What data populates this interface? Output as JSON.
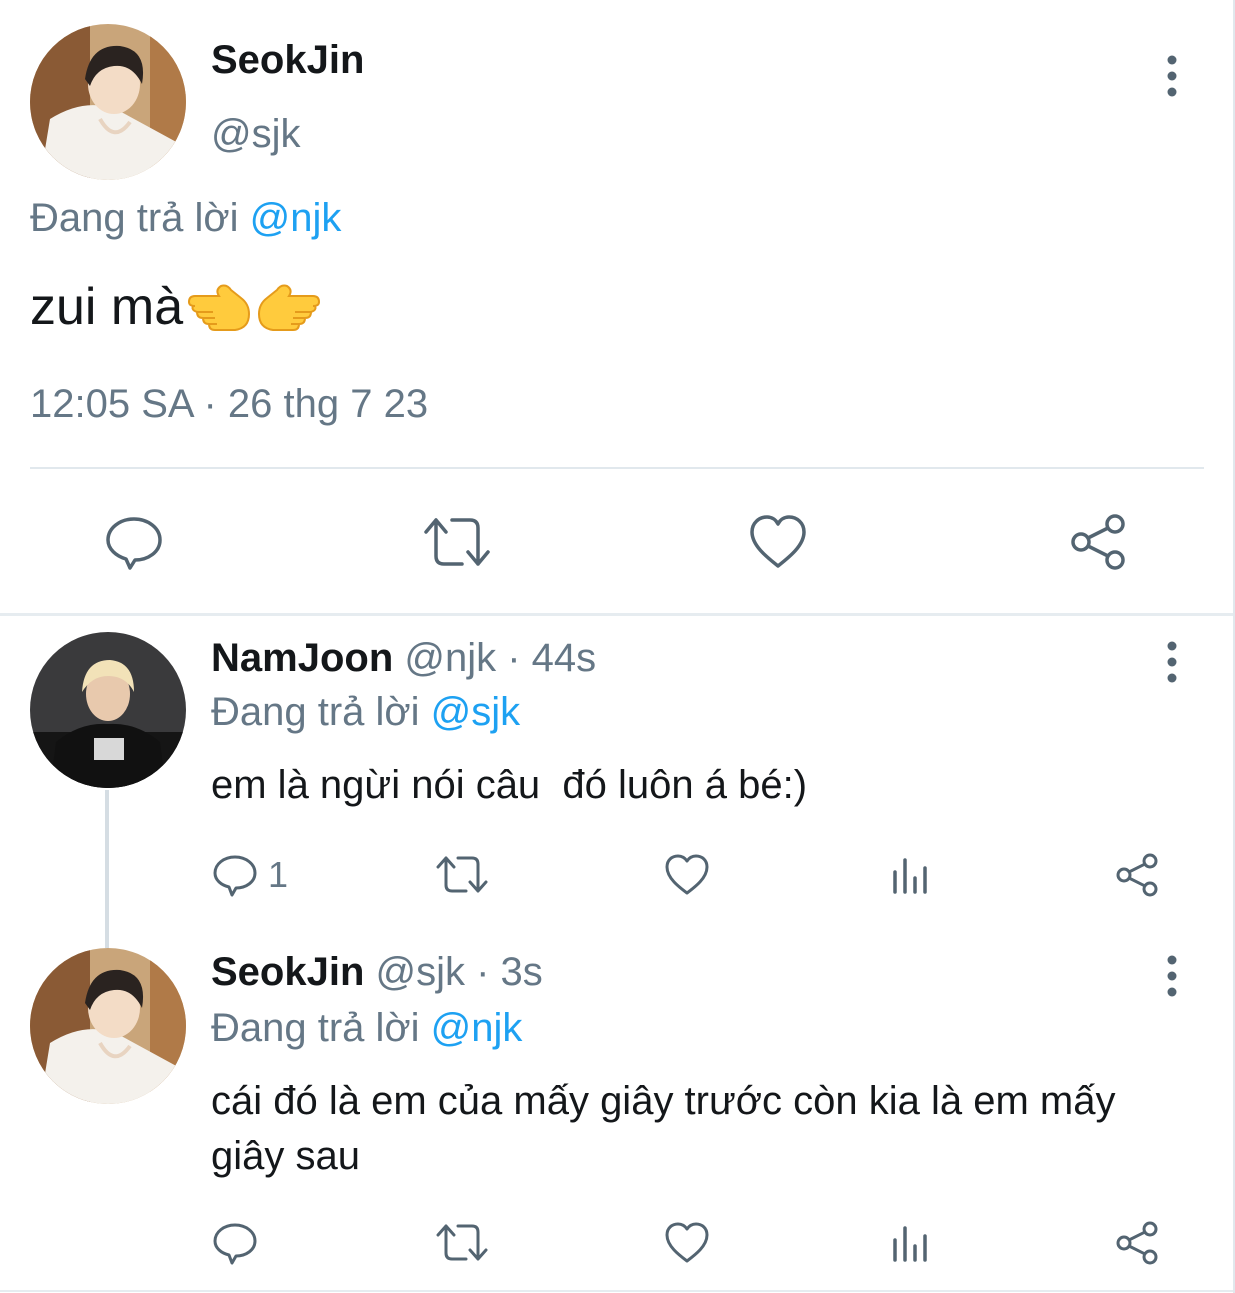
{
  "main_tweet": {
    "name": "SeokJin",
    "handle": "@sjk",
    "reply_prefix": "Đang trả lời ",
    "reply_mention": "@njk",
    "text": "zui mà",
    "emoji": [
      "backhand-index-pointing-left",
      "backhand-index-pointing-right"
    ],
    "timestamp": "12:05 SA · 26 thg 7 23",
    "actions": [
      "reply-icon",
      "retweet-icon",
      "like-icon",
      "share-icon"
    ]
  },
  "replies": [
    {
      "name": "NamJoon",
      "handle_time": " @njk · 44s",
      "reply_prefix": "Đang trả lời ",
      "reply_mention": "@sjk",
      "text": "em là ngừi nói câu  đó luôn á bé:)",
      "reply_count": "1"
    },
    {
      "name": "SeokJin",
      "handle_time": " @sjk · 3s",
      "reply_prefix": "Đang trả lời ",
      "reply_mention": "@njk",
      "text": "cái đó là em của mấy giây trước còn kia là em mấy giây sau",
      "reply_count": ""
    }
  ],
  "colors": {
    "text_primary": "#14171a",
    "text_secondary": "#657786",
    "mention": "#1da1f2",
    "divider": "#e1e8ed"
  }
}
